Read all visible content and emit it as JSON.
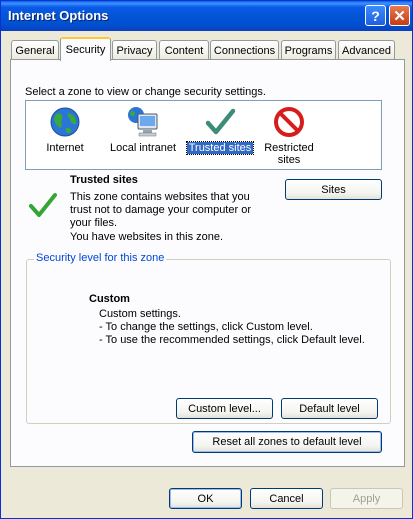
{
  "window": {
    "title": "Internet Options"
  },
  "tabs": [
    "General",
    "Security",
    "Privacy",
    "Content",
    "Connections",
    "Programs",
    "Advanced"
  ],
  "active_tab": "Security",
  "zone_prompt": "Select a zone to view or change security settings.",
  "zones": [
    {
      "label": "Internet",
      "icon": "globe-icon"
    },
    {
      "label": "Local intranet",
      "icon": "computer-globe-icon"
    },
    {
      "label": "Trusted sites",
      "icon": "checkmark-icon",
      "selected": true
    },
    {
      "label_line1": "Restricted",
      "label_line2": "sites",
      "icon": "no-entry-icon"
    }
  ],
  "zone_info": {
    "title": "Trusted sites",
    "desc1": "This zone contains websites that you",
    "desc2": "trust not to damage your computer or",
    "desc3": "your files.",
    "have": "You have websites in this zone.",
    "sites_button": "Sites"
  },
  "security_level": {
    "legend": "Security level for this zone",
    "title": "Custom",
    "line1": "Custom settings.",
    "line2": "- To change the settings, click Custom level.",
    "line3": "- To use the recommended settings, click Default level.",
    "custom_button": "Custom level...",
    "default_button": "Default level"
  },
  "reset_button": "Reset all zones to default level",
  "footer": {
    "ok": "OK",
    "cancel": "Cancel",
    "apply": "Apply"
  },
  "colors": {
    "title_bar": "#0355d6",
    "selection": "#316ac5",
    "dialog_bg": "#ece9d8"
  }
}
